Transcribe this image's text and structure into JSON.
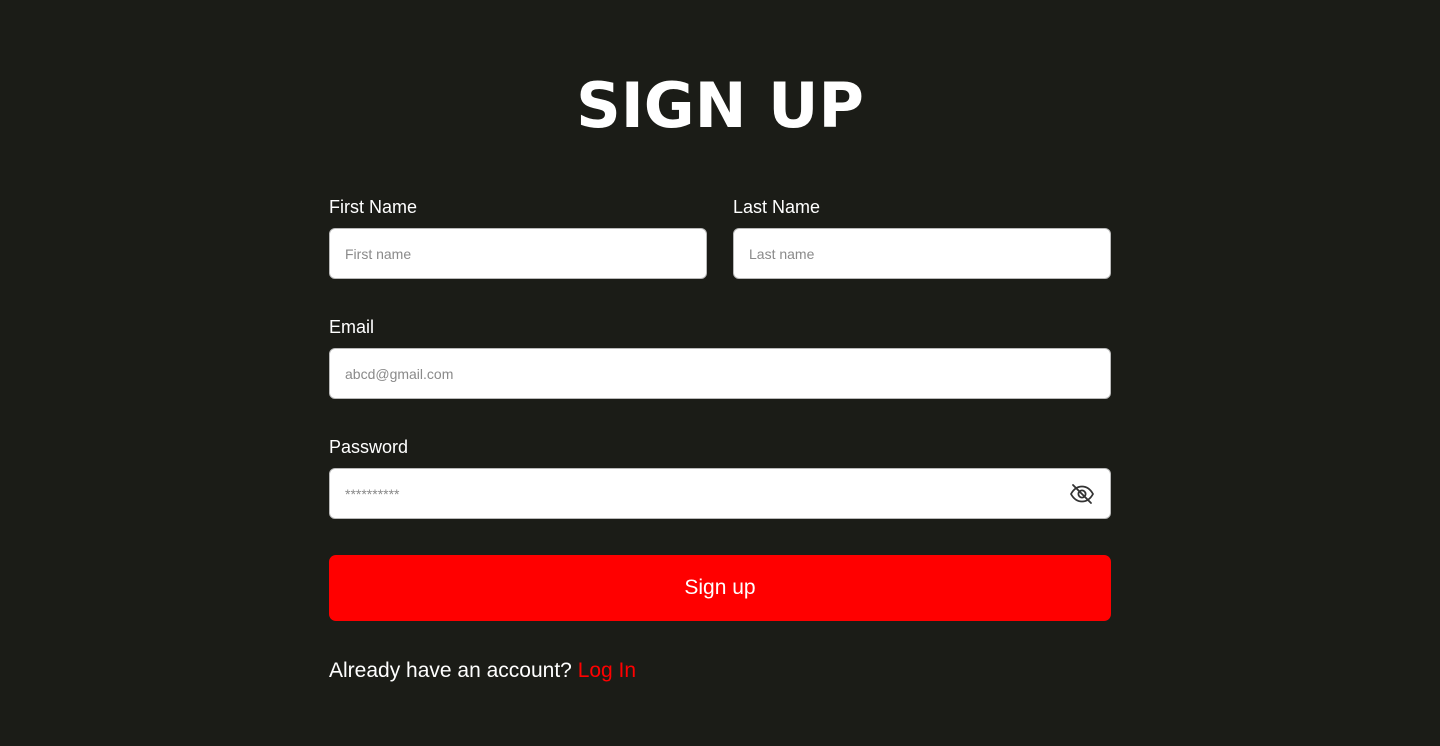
{
  "title": "SIGN UP",
  "form": {
    "first_name": {
      "label": "First Name",
      "placeholder": "First name",
      "value": ""
    },
    "last_name": {
      "label": "Last Name",
      "placeholder": "Last name",
      "value": ""
    },
    "email": {
      "label": "Email",
      "placeholder": "abcd@gmail.com",
      "value": ""
    },
    "password": {
      "label": "Password",
      "placeholder": "**********",
      "value": "",
      "visibility_icon": "eye-off-icon"
    },
    "submit_label": "Sign up"
  },
  "footer": {
    "prompt": "Already have an account?",
    "link_label": "Log In"
  },
  "colors": {
    "background": "#1b1c17",
    "accent": "#ff0000",
    "text": "#ffffff"
  }
}
